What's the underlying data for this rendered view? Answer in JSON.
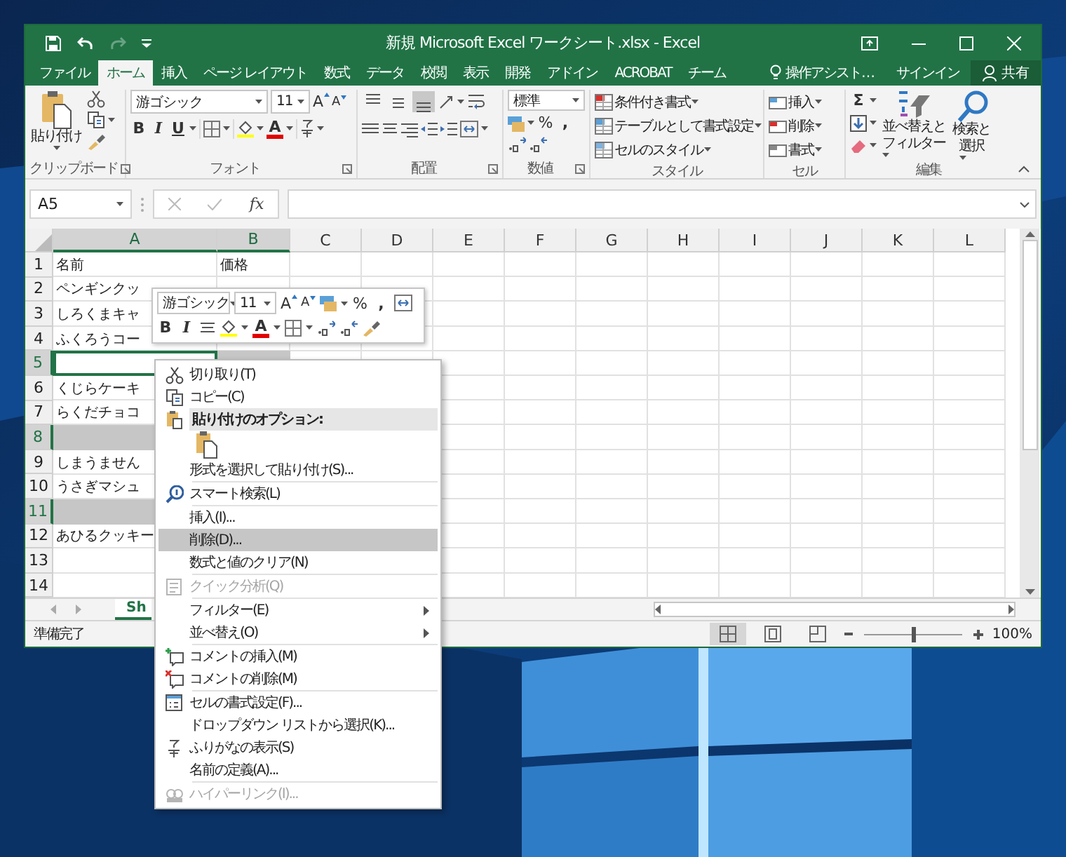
{
  "window": {
    "title": "新規 Microsoft Excel ワークシート.xlsx - Excel"
  },
  "quick_access": [
    {
      "kind": "save",
      "disabled": false
    },
    {
      "kind": "undo",
      "disabled": false
    },
    {
      "kind": "redo",
      "disabled": true
    },
    {
      "kind": "customize",
      "disabled": false
    }
  ],
  "tabs": [
    {
      "label": "ファイル",
      "selected": false
    },
    {
      "label": "ホーム",
      "selected": true
    },
    {
      "label": "挿入",
      "selected": false
    },
    {
      "label": "ページ レイアウト",
      "selected": false
    },
    {
      "label": "数式",
      "selected": false
    },
    {
      "label": "データ",
      "selected": false
    },
    {
      "label": "校閲",
      "selected": false
    },
    {
      "label": "表示",
      "selected": false
    },
    {
      "label": "開発",
      "selected": false
    },
    {
      "label": "アドイン",
      "selected": false
    },
    {
      "label": "ACROBAT",
      "selected": false
    },
    {
      "label": "チーム",
      "selected": false
    }
  ],
  "tell_me": "操作アシスト…",
  "sign_in": "サインイン",
  "share": "共有",
  "ribbon": {
    "clipboard": {
      "paste": "貼り付け",
      "label": "クリップボード"
    },
    "font": {
      "name": "游ゴシック",
      "size": "11",
      "grow": "A",
      "shrink": "A",
      "bold": "B",
      "italic": "I",
      "underline": "U",
      "font_color": "A",
      "label": "フォント"
    },
    "alignment": {
      "label": "配置",
      "vertical": [
        {
          "selected": false
        },
        {
          "selected": false
        },
        {
          "selected": true
        }
      ]
    },
    "number": {
      "format": "標準",
      "percent": "%",
      "comma": ",",
      "label": "数値"
    },
    "styles": {
      "items": [
        "条件付き書式",
        "テーブルとして書式設定",
        "セルのスタイル"
      ],
      "label": "スタイル"
    },
    "cells": {
      "items": [
        "挿入",
        "削除",
        "書式"
      ],
      "label": "セル"
    },
    "editing": {
      "sigma": "Σ",
      "sort": [
        "並べ替えと",
        "フィルター"
      ],
      "find": [
        "検索と",
        "選択"
      ],
      "label": "編集"
    }
  },
  "formula_bar": {
    "name_box": "A5",
    "function_symbol": "fx"
  },
  "columns": [
    {
      "label": "A",
      "selected": true
    },
    {
      "label": "B",
      "selected": true
    },
    {
      "label": "C",
      "selected": false
    },
    {
      "label": "D",
      "selected": false
    },
    {
      "label": "E",
      "selected": false
    },
    {
      "label": "F",
      "selected": false
    },
    {
      "label": "G",
      "selected": false
    },
    {
      "label": "H",
      "selected": false
    },
    {
      "label": "I",
      "selected": false
    },
    {
      "label": "J",
      "selected": false
    },
    {
      "label": "K",
      "selected": false
    },
    {
      "label": "L",
      "selected": false
    }
  ],
  "rows": [
    {
      "header": "1",
      "selected": false,
      "cells": [
        "名前",
        "価格"
      ]
    },
    {
      "header": "2",
      "selected": false,
      "cells": [
        "ペンギンクッ"
      ]
    },
    {
      "header": "3",
      "selected": false,
      "cells": [
        "しろくまキャ"
      ]
    },
    {
      "header": "4",
      "selected": false,
      "cells": [
        "ふくろうコー"
      ]
    },
    {
      "header": "5",
      "selected": true,
      "active_cell": true,
      "cells": []
    },
    {
      "header": "6",
      "selected": false,
      "cells": [
        "くじらケーキ"
      ]
    },
    {
      "header": "7",
      "selected": false,
      "cells": [
        "らくだチョコ"
      ]
    },
    {
      "header": "8",
      "selected": true,
      "cells": []
    },
    {
      "header": "9",
      "selected": false,
      "cells": [
        "しまうません"
      ]
    },
    {
      "header": "10",
      "selected": false,
      "cells": [
        "うさぎマシュ"
      ]
    },
    {
      "header": "11",
      "selected": true,
      "cells": []
    },
    {
      "header": "12",
      "selected": false,
      "cells": [
        "あひるクッキー"
      ]
    },
    {
      "header": "13",
      "selected": false,
      "cells": []
    },
    {
      "header": "14",
      "selected": false,
      "cells": []
    }
  ],
  "sheet_tab": {
    "label": "Sh",
    "selected": true
  },
  "status_bar": {
    "status": "準備完了",
    "views": [
      {
        "selected": true
      },
      {
        "selected": false
      },
      {
        "selected": false
      }
    ],
    "zoom_slider": {
      "level": 0.5
    },
    "zoom": "100%"
  },
  "mini_toolbar": {
    "font": "游ゴシック",
    "size": "11",
    "grow": "A",
    "shrink": "A",
    "percent": "%",
    "comma": ",",
    "bold": "B",
    "italic": "I",
    "font_color": "A"
  },
  "context_menu": [
    {
      "kind": "item",
      "label": "切り取り(T)",
      "disabled": false,
      "selected": false,
      "submenu": false
    },
    {
      "kind": "item",
      "label": "コピー(C)",
      "disabled": false,
      "selected": false,
      "submenu": false
    },
    {
      "kind": "header",
      "label": "貼り付けのオプション:"
    },
    {
      "kind": "paste-options"
    },
    {
      "kind": "item",
      "label": "形式を選択して貼り付け(S)...",
      "disabled": false,
      "selected": false,
      "submenu": false
    },
    {
      "kind": "separator"
    },
    {
      "kind": "item",
      "label": "スマート検索(L)",
      "disabled": false,
      "selected": false,
      "submenu": false
    },
    {
      "kind": "separator"
    },
    {
      "kind": "item",
      "label": "挿入(I)...",
      "disabled": false,
      "selected": false,
      "submenu": false
    },
    {
      "kind": "item",
      "label": "削除(D)...",
      "disabled": false,
      "selected": true,
      "submenu": false
    },
    {
      "kind": "item",
      "label": "数式と値のクリア(N)",
      "disabled": false,
      "selected": false,
      "submenu": false
    },
    {
      "kind": "separator"
    },
    {
      "kind": "item",
      "label": "クイック分析(Q)",
      "disabled": true,
      "selected": false,
      "submenu": false
    },
    {
      "kind": "separator"
    },
    {
      "kind": "item",
      "label": "フィルター(E)",
      "disabled": false,
      "selected": false,
      "submenu": true
    },
    {
      "kind": "item",
      "label": "並べ替え(O)",
      "disabled": false,
      "selected": false,
      "submenu": true
    },
    {
      "kind": "separator"
    },
    {
      "kind": "item",
      "label": "コメントの挿入(M)",
      "disabled": false,
      "selected": false,
      "submenu": false
    },
    {
      "kind": "item",
      "label": "コメントの削除(M)",
      "disabled": false,
      "selected": false,
      "submenu": false
    },
    {
      "kind": "separator"
    },
    {
      "kind": "item",
      "label": "セルの書式設定(F)...",
      "disabled": false,
      "selected": false,
      "submenu": false
    },
    {
      "kind": "item",
      "label": "ドロップダウン リストから選択(K)...",
      "disabled": false,
      "selected": false,
      "submenu": false
    },
    {
      "kind": "item",
      "label": "ふりがなの表示(S)",
      "disabled": false,
      "selected": false,
      "submenu": false
    },
    {
      "kind": "item",
      "label": "名前の定義(A)...",
      "disabled": false,
      "selected": false,
      "submenu": false
    },
    {
      "kind": "separator"
    },
    {
      "kind": "item",
      "label": "ハイパーリンク(I)...",
      "disabled": true,
      "selected": false,
      "submenu": false
    }
  ]
}
